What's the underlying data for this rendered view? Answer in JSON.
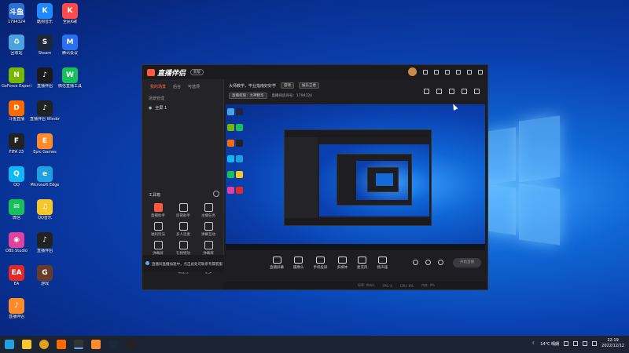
{
  "desktop": {
    "icons": [
      {
        "label": "1794324",
        "badge": "斗鱼",
        "color": "#2d6fd6"
      },
      {
        "label": "酷狗音乐",
        "badge": "K",
        "color": "#1e88ff"
      },
      {
        "label": "全民K歌",
        "badge": "K",
        "color": "#ff4a4a"
      },
      {
        "label": "回收站",
        "badge": "♻",
        "color": "#4aa3df"
      },
      {
        "label": "Steam",
        "badge": "S",
        "color": "#1b2838"
      },
      {
        "label": "腾讯会议",
        "badge": "M",
        "color": "#2a6ff0"
      },
      {
        "label": "GeForce Experience",
        "badge": "N",
        "color": "#76b900"
      },
      {
        "label": "直播伴侣",
        "badge": "♪",
        "color": "#1a1a1a"
      },
      {
        "label": "微信直播工具",
        "badge": "W",
        "color": "#18c05a"
      },
      {
        "label": "斗鱼直播",
        "badge": "D",
        "color": "#ff6a00"
      },
      {
        "label": "直播伴侣 Windows版",
        "badge": "♪",
        "color": "#222"
      },
      {
        "label": "FIFA 23",
        "badge": "F",
        "color": "#222"
      },
      {
        "label": "Epic Games",
        "badge": "E",
        "color": "#ff8a2a"
      },
      {
        "label": "QQ",
        "badge": "Q",
        "color": "#12b7f5"
      },
      {
        "label": "Microsoft Edge",
        "badge": "e",
        "color": "#1fa0e0"
      },
      {
        "label": "微信",
        "badge": "✉",
        "color": "#18c05a"
      },
      {
        "label": "QQ音乐",
        "badge": "♫",
        "color": "#f7c72a"
      },
      {
        "label": "OBS Studio",
        "badge": "◉",
        "color": "#e040a0"
      },
      {
        "label": "直播伴侣",
        "badge": "♪",
        "color": "#222"
      },
      {
        "label": "EA",
        "badge": "EA",
        "color": "#e32828"
      },
      {
        "label": "游戏",
        "badge": "G",
        "color": "#6a3a2a"
      },
      {
        "label": "直播伴侣",
        "badge": "♪",
        "color": "#ff8a2a"
      }
    ]
  },
  "app": {
    "title": "直播伴侣",
    "version": "新版",
    "left_tabs": [
      "我的场景",
      "后台",
      "可选项"
    ],
    "scene_label": "场景管理",
    "scene_item": "全屏 1",
    "tools_title": "工具箱",
    "tools": [
      "直播助手",
      "房管助手",
      "主播任务",
      "福利玩法",
      "多人连麦",
      "弹幕互动",
      "弹幕屏",
      "礼物特效",
      "弹幕库",
      "PK",
      "发红包",
      "更多"
    ],
    "room_title": "大师教学，毕业指南好好学",
    "room_tag1": "游戏",
    "room_tag2": "娱乐王者",
    "room_edit": "直播权限：大神精华",
    "room_id_label": "直播间房间号：1794324",
    "controls": [
      "直播屏幕",
      "摄像头",
      "手机投屏",
      "多媒体",
      "麦克风",
      "扬声器"
    ],
    "golive": "开始直播",
    "stats": [
      "码率: 0kb/s",
      "FPS: 0",
      "CPU: 8%",
      "内存: 0%"
    ],
    "notice": "直播间直播加速中，点击此处可联系专属客服"
  },
  "taskbar": {
    "weather": "14°C 晴朗",
    "time": "22:19",
    "date": "2022/12/12"
  }
}
